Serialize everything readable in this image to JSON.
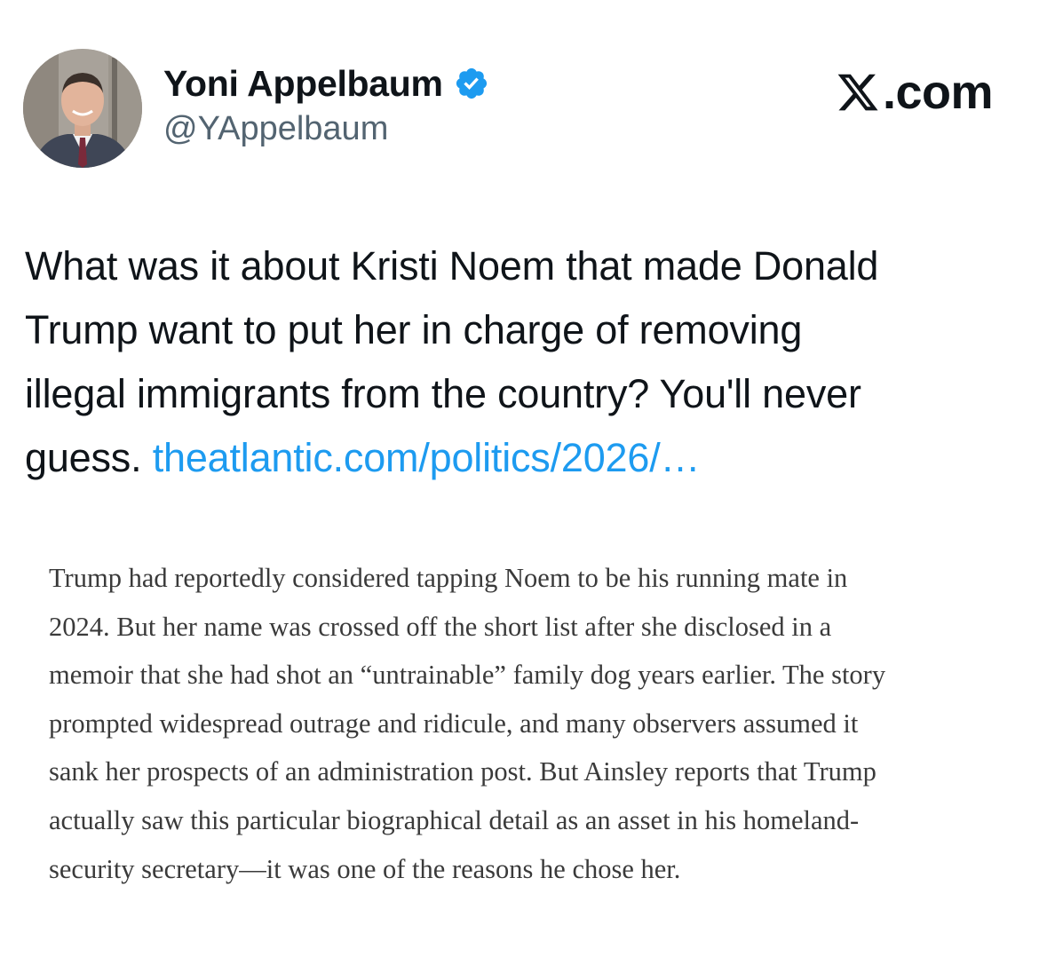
{
  "author": {
    "display_name": "Yoni Appelbaum",
    "handle": "@YAppelbaum",
    "verified": true,
    "avatar_icon": "profile-photo"
  },
  "site": {
    "logo_icon": "x-logo-icon",
    "suffix": ".com"
  },
  "tweet": {
    "lines": [
      "What was it about Kristi Noem that made Donald",
      "Trump want to put her in charge of removing",
      "illegal immigrants from the country? You'll never"
    ],
    "last_line_text": "guess. ",
    "link_text": "theatlantic.com/politics/2026/…"
  },
  "quote_image": {
    "lines": [
      "Trump had reportedly considered tapping Noem to be his running mate in",
      "2024. But her name was crossed off the short list after she disclosed in a",
      "memoir that she had shot an “untrainable” family dog years earlier. The story",
      "prompted widespread outrage and ridicule, and many observers assumed it",
      "sank her prospects of an administration post. But Ainsley reports that Trump",
      "actually saw this particular biographical detail as an asset in his homeland-",
      "security secretary—it was one of the reasons he chose her."
    ]
  },
  "colors": {
    "text": "#0f1419",
    "secondary": "#536471",
    "link": "#1d9bf0",
    "verified": "#1d9bf0",
    "quote_text": "#3a3a3a"
  }
}
